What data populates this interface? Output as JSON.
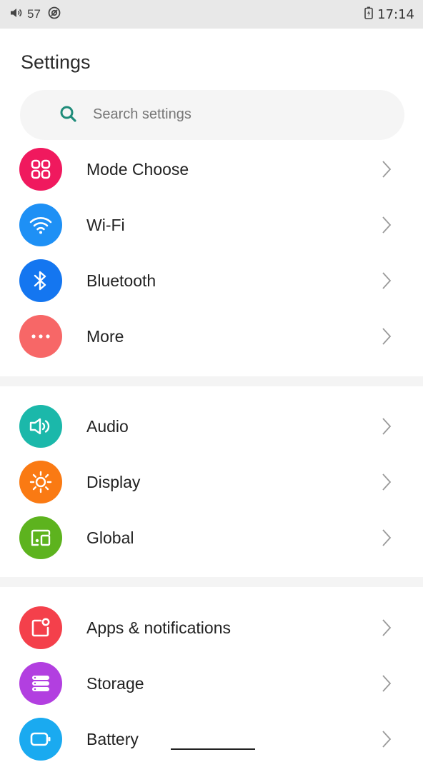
{
  "status_bar": {
    "volume_value": "57",
    "time": "17:14",
    "icons": [
      "volume-icon",
      "sync-icon",
      "battery-charging-icon"
    ]
  },
  "title": "Settings",
  "search": {
    "placeholder": "Search settings"
  },
  "groups": [
    {
      "items": [
        {
          "label": "Mode Choose",
          "icon": "grid-icon",
          "color": "#F0195E"
        },
        {
          "label": "Wi-Fi",
          "icon": "wifi-icon",
          "color": "#1E90F5"
        },
        {
          "label": "Bluetooth",
          "icon": "bluetooth-icon",
          "color": "#1476F0"
        },
        {
          "label": "More",
          "icon": "more-dots-icon",
          "color": "#F76767"
        }
      ]
    },
    {
      "items": [
        {
          "label": "Audio",
          "icon": "speaker-icon",
          "color": "#1BB8AA"
        },
        {
          "label": "Display",
          "icon": "brightness-icon",
          "color": "#FA7A13"
        },
        {
          "label": "Global",
          "icon": "devices-icon",
          "color": "#5DB31E"
        }
      ]
    },
    {
      "items": [
        {
          "label": "Apps & notifications",
          "icon": "apps-notification-icon",
          "color": "#F4404B"
        },
        {
          "label": "Storage",
          "icon": "storage-icon",
          "color": "#B23FE0"
        },
        {
          "label": "Battery",
          "icon": "battery-icon",
          "color": "#1AAAF0"
        }
      ]
    }
  ]
}
